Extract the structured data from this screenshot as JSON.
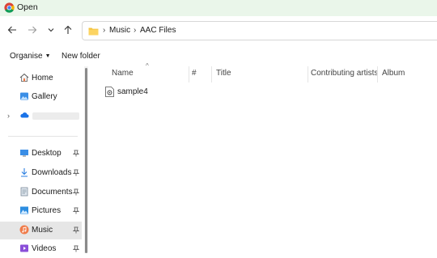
{
  "window": {
    "title": "Open"
  },
  "navigation": {
    "breadcrumbs": [
      "Music",
      "AAC Files"
    ]
  },
  "commands": {
    "organise_label": "Organise",
    "new_folder_label": "New folder"
  },
  "sidebar": {
    "items": [
      {
        "label": "Home",
        "icon": "home-icon"
      },
      {
        "label": "Gallery",
        "icon": "gallery-icon"
      },
      {
        "label": "",
        "icon": "cloud-icon"
      },
      {
        "label": "Desktop",
        "icon": "desktop-icon"
      },
      {
        "label": "Downloads",
        "icon": "download-icon"
      },
      {
        "label": "Documents",
        "icon": "documents-icon"
      },
      {
        "label": "Pictures",
        "icon": "pictures-icon"
      },
      {
        "label": "Music",
        "icon": "music-icon",
        "selected": true
      },
      {
        "label": "Videos",
        "icon": "videos-icon"
      }
    ]
  },
  "file_list": {
    "columns": [
      "Name",
      "#",
      "Title",
      "Contributing artists",
      "Album"
    ],
    "rows": [
      {
        "name": "sample4"
      }
    ]
  },
  "colors": {
    "titlebar_bg": "#eaf6ea",
    "selected_bg": "#e6e6e6",
    "folder_yellow": "#f4c33e",
    "cloud_blue": "#1a73e8",
    "music_orange": "#f07c4a"
  }
}
